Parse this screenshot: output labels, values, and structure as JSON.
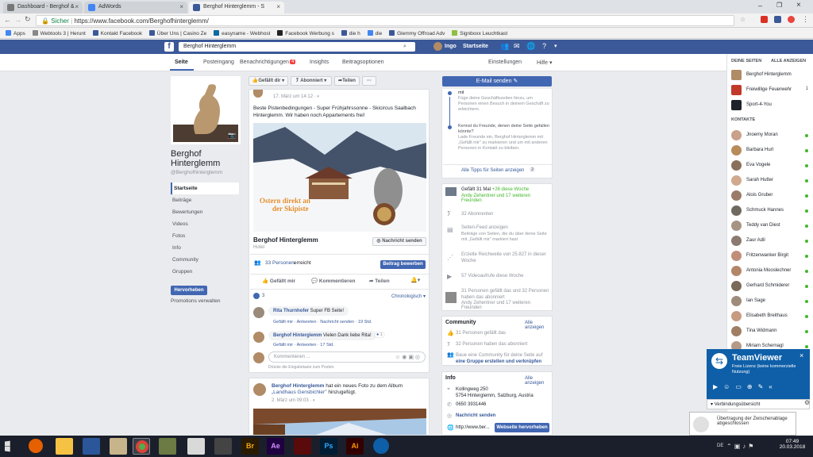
{
  "browser": {
    "tabs": [
      {
        "label": "Dashboard - Berghof &",
        "color": "#4e4e4e"
      },
      {
        "label": "AdWords",
        "color": "#4285f4"
      },
      {
        "label": "Berghof Hinterglemm - S",
        "color": "#3b5998"
      }
    ],
    "secure_label": "Sicher",
    "url": "https://www.facebook.com/Berghofhinterglemm/",
    "bookmarks": [
      "Apps",
      "Webtools 3 | Herunt",
      "Kontakt Facebook",
      "Über Uns | Casino Ze",
      "easyname - Webhost",
      "Facebook Werbung s",
      "die h",
      "die",
      "Glemmy Offroad Adv",
      "Signboxx Leuchtkast"
    ]
  },
  "fb_top": {
    "search_value": "Berghof Hinterglemm",
    "user_name": "Ingo",
    "home_label": "Startseite"
  },
  "page_nav": {
    "tabs": [
      "Seite",
      "Posteingang",
      "Benachrichtigungen",
      "Insights",
      "Beitragsoptionen"
    ],
    "badge": "4",
    "settings": "Einstellungen",
    "help": "Hilfe ▾"
  },
  "page": {
    "name_line1": "Berghof",
    "name_line2": "Hinterglemm",
    "handle": "@Berghofhinterglemm",
    "nav": [
      "Startseite",
      "Beiträge",
      "Bewertungen",
      "Videos",
      "Fotos",
      "Info",
      "Community",
      "Gruppen"
    ],
    "promote_btn": "Hervorheben",
    "promotions": "Promotions verwalten"
  },
  "actions": {
    "liked": "Gefällt dir ▾",
    "subscribed": "Abonniert ▾",
    "share": "Teilen",
    "more": "···",
    "email_btn": "E-Mail senden ✎"
  },
  "post1": {
    "date": "17. März um 14:12 · ◐",
    "text": "Beste Pistenbedingungen - Super Frühjahrssonne - Skicircus Saalbach Hinterglemm. Wir haben noch Appartements frei!",
    "overlay_line1": "Ostern direkt an",
    "overlay_line2": "der Skipiste",
    "page_name": "Berghof Hinterglemm",
    "page_type": "Hotel",
    "message_btn": "Nachricht senden",
    "reach_prefix": "33 Personen",
    "reach_suffix": "erreicht",
    "boost_btn": "Beitrag bewerben",
    "like": "Gefällt mir",
    "comment": "Kommentieren",
    "share": "Teilen",
    "reactions_count": "3",
    "sort": "Chronologisch ▾",
    "comments": [
      {
        "author": "Rita Thurnhofer",
        "text": "Super FB Seite!",
        "meta": "Gefällt mir · Antworten · Nachricht senden · 19 Std."
      },
      {
        "author": "Berghof Hinterglemm",
        "text": "Vielen Dank liebe Rita!",
        "meta": "Gefällt mir · Antworten · 17 Std.",
        "likes": "1"
      }
    ],
    "comment_placeholder": "Kommentieren ...",
    "enter_hint": "Drücke die Eingabetaste zum Posten."
  },
  "post2": {
    "author": "Berghof Hinterglemm",
    "text_prefix": "hat ein neues Foto zu dem Album",
    "album": "„Landhaus Gensbichler\"",
    "text_suffix": "hinzugefügt.",
    "date": "2. März um 09:03 · ◐"
  },
  "right_top": {
    "tip1": "Füge deine Geschäftszeiten hinzu, um Personen einen Besuch in deinem Geschäft zu erleichtern.",
    "tip2_title": "Kennst du Freunde, denen deine Seite gefallen könnte?",
    "tip2_text": "Lade Freunde ein, Berghof Hinterglemm mit „Gefällt mir\" zu markieren und um mit anderen Personen in Kontakt zu bleiben.",
    "all_tips": "Alle Tipps für Seiten anzeigen",
    "all_tips_count": "2"
  },
  "stats": {
    "likes": "Gefällt 31 Mal",
    "likes_week": "+26 diese Woche",
    "friends_like": "Andy Zehentner und 17 weiteren Freunden",
    "subscribers": "32 Abonnenten",
    "feed_title": "Seiten-Feed anzeigen",
    "feed_text": "Beiträge von Seiten, die du über deine Seite mit „Gefällt mir\" markiert hast",
    "reach": "Erzielte Reichweite von 25.827 in dieser Woche",
    "videos": "57 Videoaufrufe diese Woche",
    "like_and_sub": "31 Personen gefällt das und 32 Personen haben das abonniert",
    "friends2": "Andy Zehentner und 17 weiteren Freunden"
  },
  "community": {
    "title": "Community",
    "show_all": "Alle anzeigen",
    "likes": "31 Personen gefällt das",
    "subs": "32 Personen haben das abonniert",
    "build_prefix": "Baue eine Community für deine Seite auf",
    "build_link": "eine Gruppe erstellen und verknüpfen"
  },
  "info": {
    "title": "Info",
    "show_all": "Alle anzeigen",
    "address1": "Kollingweg 250",
    "address2": "5754 Hinterglemm, Salzburg, Austria",
    "phone": "0650 3931446",
    "message": "Nachricht senden",
    "website": "http://www.ber...",
    "website_btn": "Webseite hervorheben"
  },
  "chat": {
    "pages_title": "DEINE SEITEN",
    "pages_all": "ALLE ANZEIGEN",
    "pages": [
      "Berghof Hinterglemm",
      "Freiwillige Feuerwehr",
      "Sport-4-You"
    ],
    "pages_badge": "1",
    "contacts_title": "KONTAKTE",
    "contacts": [
      "Jnoemy Moran",
      "Barbara Hurl",
      "Eva Vogele",
      "Sarah Hutter",
      "Alois Gruber",
      "Schmuck Hannes",
      "Teddy van Diest",
      "Zaur Adil",
      "Fritzenwanker Birgit",
      "Antonia Mooslechner",
      "Gerhard Schmiderer",
      "Ian Sage",
      "Elisabeth Breithaus",
      "Tina Widmann",
      "Miriam Schernagl"
    ]
  },
  "teamviewer": {
    "title": "TeamViewer",
    "subtitle": "Freie Lizenz (keine kommerzielle Nutzung)",
    "connections": "Verbindungsübersicht",
    "toast": "Übertragung der Zwischenablage abgeschlossen"
  },
  "taskbar": {
    "lang": "DE",
    "time": "07:49",
    "date": "20.03.2018"
  }
}
